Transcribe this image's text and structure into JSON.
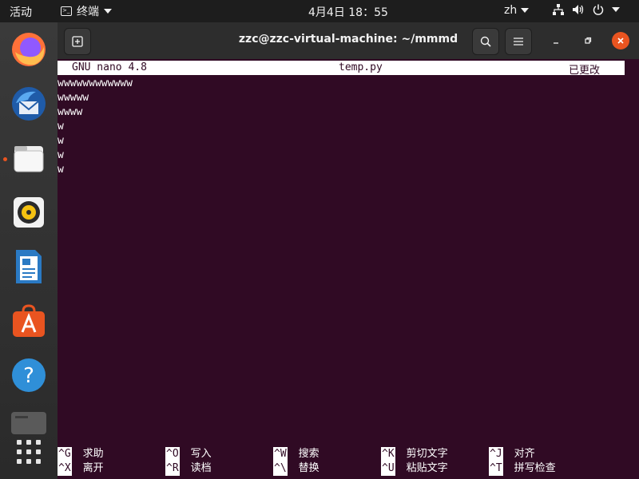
{
  "topbar": {
    "activities": "活动",
    "app_name": "终端",
    "clock": "4月4日 18：55",
    "language": "zh"
  },
  "dock": {
    "items": [
      {
        "name": "firefox-icon"
      },
      {
        "name": "thunderbird-icon"
      },
      {
        "name": "files-icon"
      },
      {
        "name": "rhythmbox-icon"
      },
      {
        "name": "writer-icon"
      },
      {
        "name": "software-icon"
      },
      {
        "name": "help-icon"
      },
      {
        "name": "terminal-icon"
      },
      {
        "name": "show-apps-icon"
      }
    ]
  },
  "window": {
    "title": "zzc@zzc-virtual-machine: ~/mmmd"
  },
  "nano": {
    "version": "GNU nano 4.8",
    "filename": "temp.py",
    "status": "已更改",
    "lines": [
      "wwwwwwwwwwww",
      "wwwww",
      "wwww",
      "w",
      "w",
      "w",
      "w"
    ]
  },
  "shortcuts": [
    {
      "key": "^G",
      "label": "求助"
    },
    {
      "key": "^O",
      "label": "写入"
    },
    {
      "key": "^W",
      "label": "搜索"
    },
    {
      "key": "^K",
      "label": "剪切文字"
    },
    {
      "key": "^J",
      "label": "对齐"
    },
    {
      "key": "^X",
      "label": "离开"
    },
    {
      "key": "^R",
      "label": "读档"
    },
    {
      "key": "^\\",
      "label": "替换"
    },
    {
      "key": "^U",
      "label": "粘贴文字"
    },
    {
      "key": "^T",
      "label": "拼写检查"
    }
  ],
  "colors": {
    "terminal_bg": "#300a24",
    "accent": "#e95420"
  }
}
